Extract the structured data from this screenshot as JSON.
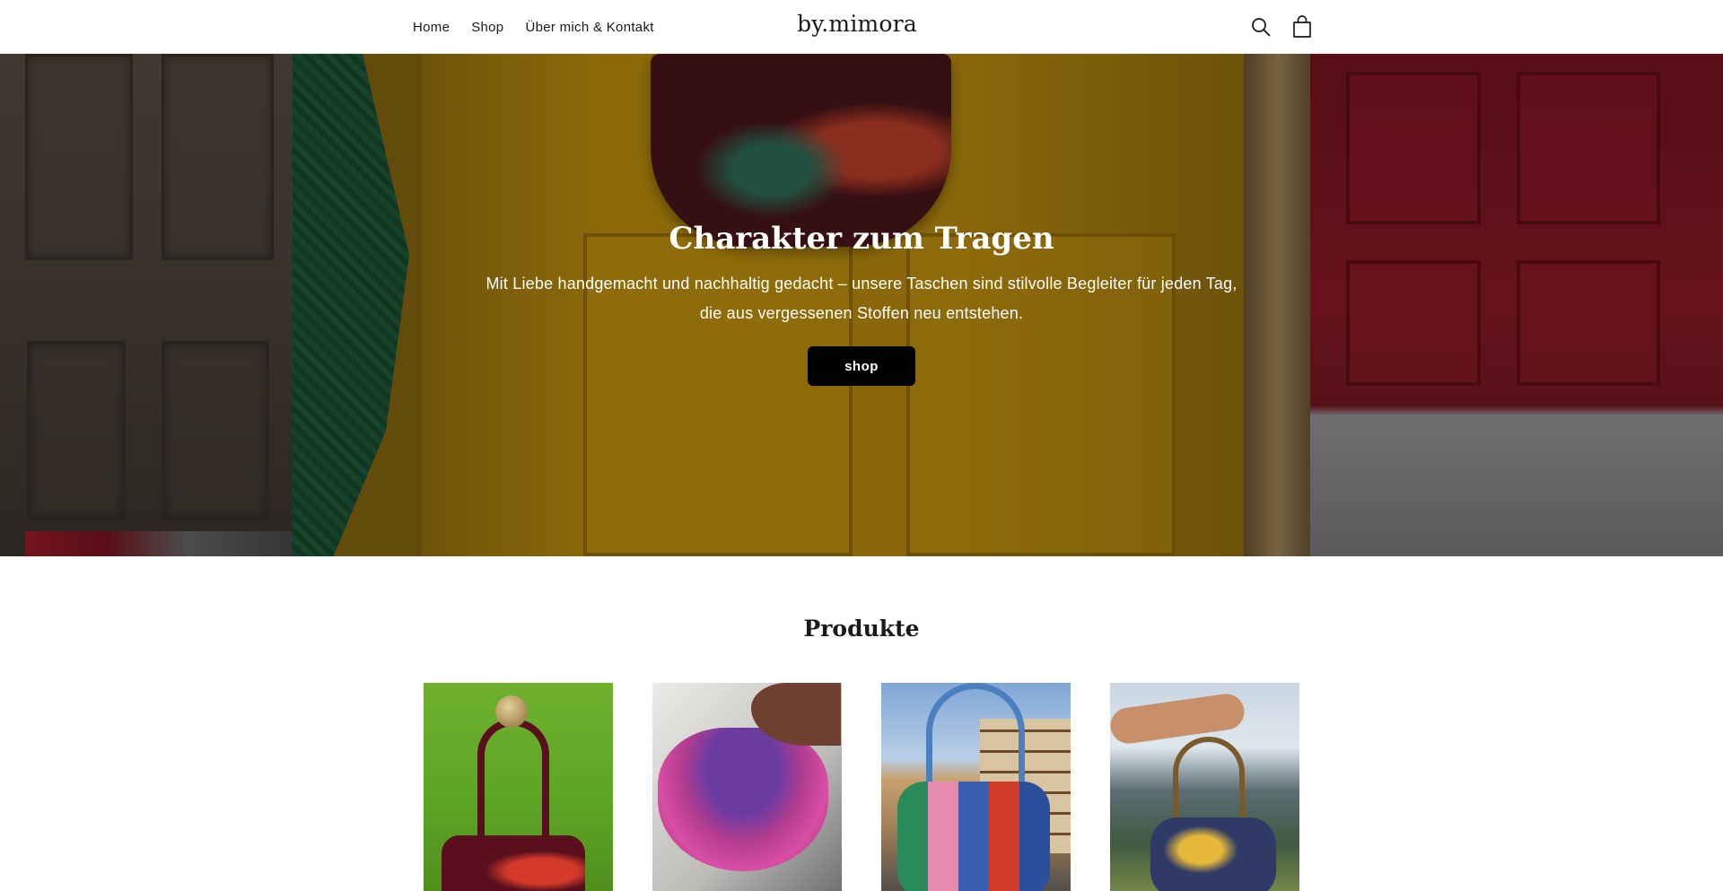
{
  "header": {
    "nav": [
      {
        "label": "Home"
      },
      {
        "label": "Shop"
      },
      {
        "label": "Über mich & Kontakt"
      }
    ],
    "logo": "by.mimora",
    "icons": [
      "search-icon",
      "shopping-bag-icon"
    ]
  },
  "hero": {
    "title": "Charakter zum Tragen",
    "subtitle": "Mit Liebe handgemacht und nachhaltig gedacht – unsere Taschen sind stilvolle Begleiter für jeden Tag, die aus vergessenen Stoffen neu entstehen.",
    "button_label": "shop"
  },
  "products": {
    "title": "Produkte",
    "items": [
      {
        "image": "crochet-bag-on-green-door"
      },
      {
        "image": "purple-pink-crochet-bag-in-hand"
      },
      {
        "image": "striped-crochet-bag-in-old-town"
      },
      {
        "image": "blue-crochet-bag-mountain-view"
      }
    ]
  },
  "colors": {
    "button_bg": "#000000",
    "text": "#121212",
    "background": "#ffffff"
  }
}
